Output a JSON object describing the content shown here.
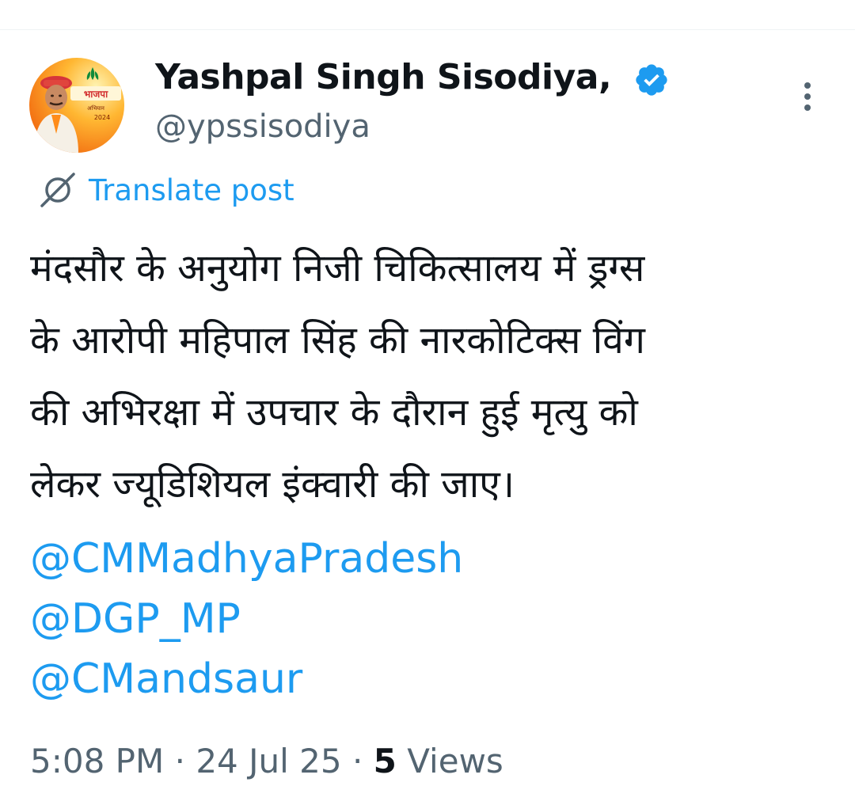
{
  "post": {
    "author": {
      "name": "Yashpal Singh Sisodiya,",
      "handle": "@ypssisodiya",
      "verified": true,
      "avatar_banner_text": "भाजपा",
      "avatar_caption": "अभियान",
      "avatar_year": "2024"
    },
    "translate_label": "Translate post",
    "text_lines": [
      "मंदसौर के अनुयोग निजी चिकित्सालय में ड्रग्स",
      "के आरोपी महिपाल सिंह की नारकोटिक्स विंग",
      "की अभिरक्षा में उपचार के दौरान हुई मृत्यु को",
      "लेकर ज्यूडिशियल इंक्वारी की जाए।"
    ],
    "mentions": [
      "@CMMadhyaPradesh",
      "@DGP_MP",
      "@CMandsaur"
    ],
    "meta": {
      "time": "5:08 PM",
      "separator": "·",
      "date": "24 Jul 25",
      "views_count": "5",
      "views_label": "Views"
    }
  },
  "colors": {
    "accent": "#1d9bf0",
    "text_primary": "#0f1419",
    "text_secondary": "#536471",
    "divider": "#eff3f4"
  },
  "icons": [
    "verified-badge-icon",
    "more-options-icon",
    "translate-globe-icon"
  ]
}
